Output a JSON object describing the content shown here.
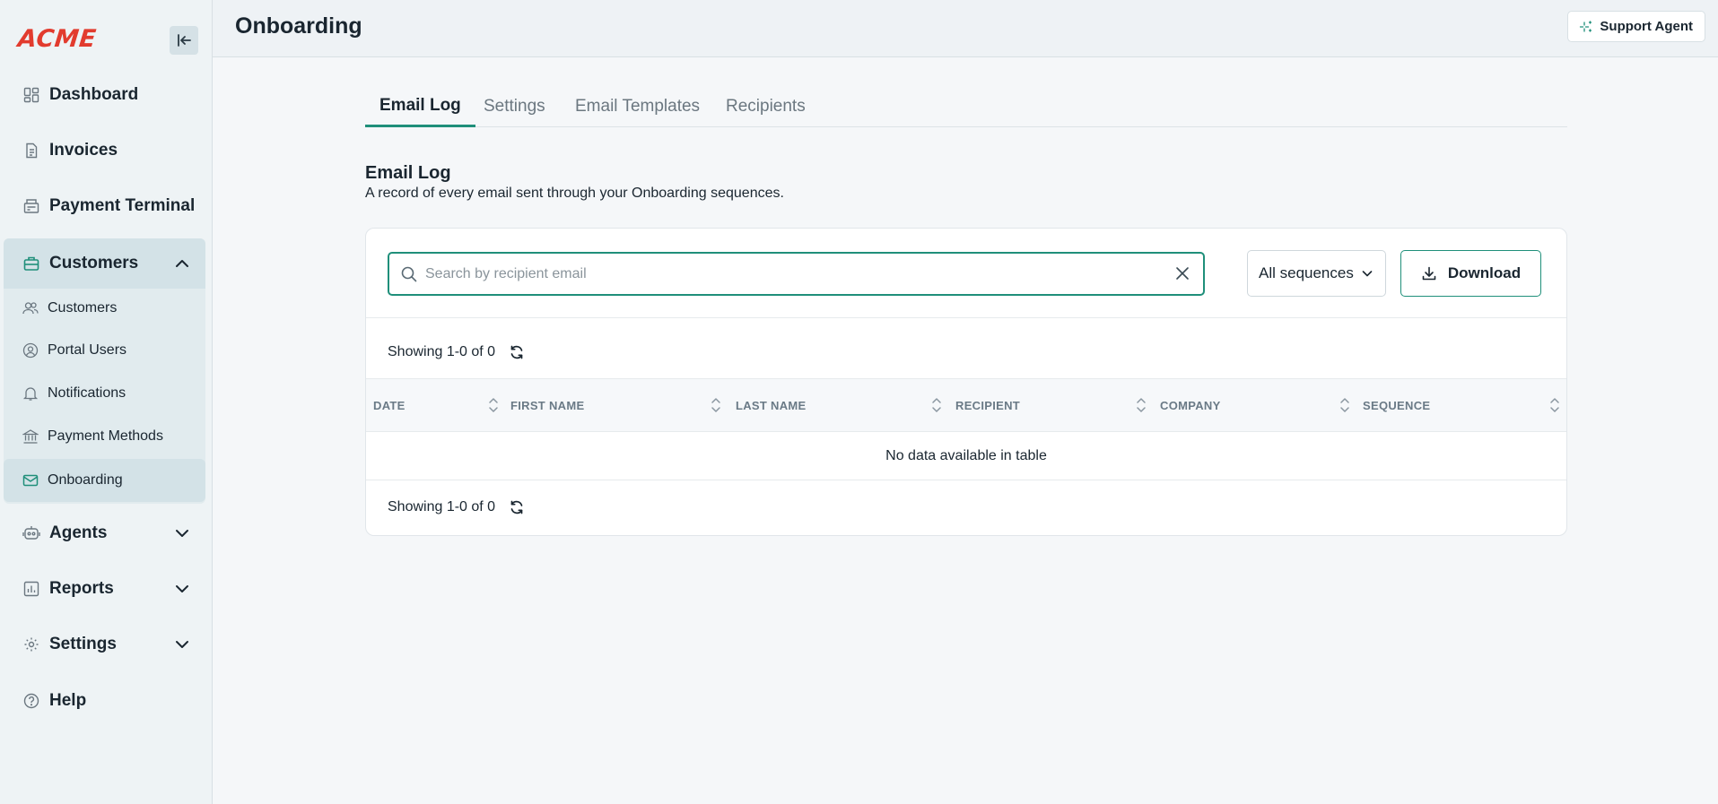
{
  "app": {
    "logo": "ACME"
  },
  "sidebar": {
    "items": [
      {
        "label": "Dashboard",
        "icon": "dashboard-icon"
      },
      {
        "label": "Invoices",
        "icon": "invoice-icon"
      },
      {
        "label": "Payment Terminal",
        "icon": "terminal-icon"
      },
      {
        "label": "Customers",
        "icon": "briefcase-icon",
        "expanded": true
      },
      {
        "label": "Agents",
        "icon": "robot-icon"
      },
      {
        "label": "Reports",
        "icon": "reports-icon"
      },
      {
        "label": "Settings",
        "icon": "gear-icon"
      },
      {
        "label": "Help",
        "icon": "help-icon"
      }
    ],
    "customers_sub": [
      {
        "label": "Customers",
        "icon": "users-icon"
      },
      {
        "label": "Portal Users",
        "icon": "user-circle-icon"
      },
      {
        "label": "Notifications",
        "icon": "bell-icon"
      },
      {
        "label": "Payment Methods",
        "icon": "bank-icon"
      },
      {
        "label": "Onboarding",
        "icon": "mail-icon",
        "active": true
      }
    ]
  },
  "header": {
    "title": "Onboarding",
    "support_label": "Support Agent"
  },
  "tabs": [
    "Email Log",
    "Settings",
    "Email Templates",
    "Recipients"
  ],
  "section": {
    "title": "Email Log",
    "subtitle": "A record of every email sent through your Onboarding sequences."
  },
  "toolbar": {
    "search_placeholder": "Search by recipient email",
    "search_value": "",
    "sequence_selected": "All sequences",
    "download_label": "Download"
  },
  "table": {
    "showing_top": "Showing 1-0 of 0",
    "showing_bottom": "Showing 1-0 of 0",
    "columns": [
      "Date",
      "First Name",
      "Last Name",
      "Recipient",
      "Company",
      "Sequence"
    ],
    "empty_message": "No data available in table"
  },
  "colors": {
    "accent": "#1f8f7a",
    "logo": "#e23b2e"
  }
}
